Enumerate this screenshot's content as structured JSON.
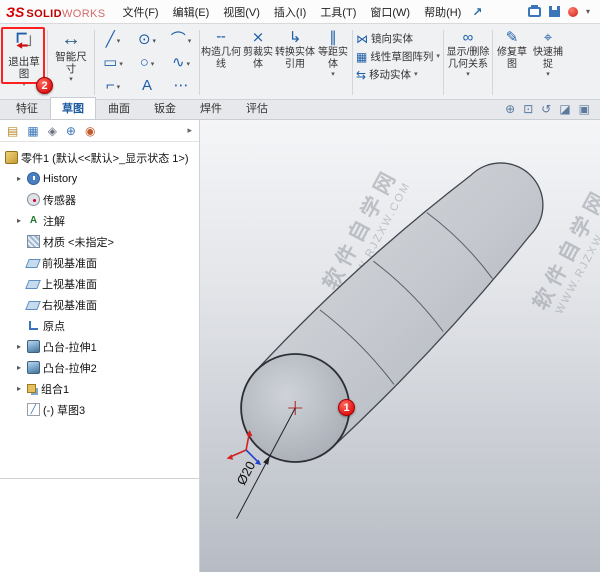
{
  "colors": {
    "annotation_red": "#ff2020",
    "solidworks_red": "#c00000",
    "accent_blue": "#1f5fa9"
  },
  "titlebar": {
    "logo_mark": "ЗS",
    "logo_solid": "SOLID",
    "logo_works": "WORKS",
    "menus": [
      "文件(F)",
      "编辑(E)",
      "视图(V)",
      "插入(I)",
      "工具(T)",
      "窗口(W)",
      "帮助(H)"
    ]
  },
  "ribbon": {
    "exit_sketch": "退出草图",
    "smart_dimension": "智能尺寸",
    "tools": [
      "构造几何线",
      "剪裁实体",
      "转换实体引用",
      "等距实体"
    ],
    "stack_tools": [
      "镜向实体",
      "线性草图阵列",
      "移动实体"
    ],
    "relations": "显示/删除几何关系",
    "repair": "修复草图",
    "snaps": "快速捕捉"
  },
  "tabs": {
    "items": [
      "特征",
      "草图",
      "曲面",
      "钣金",
      "焊件",
      "评估"
    ],
    "active": "草图"
  },
  "tree": {
    "root": "零件1 (默认<<默认>_显示状态 1>)",
    "items": [
      {
        "label": "History"
      },
      {
        "label": "传感器"
      },
      {
        "label": "注解"
      },
      {
        "label": "材质 <未指定>"
      },
      {
        "label": "前视基准面"
      },
      {
        "label": "上视基准面"
      },
      {
        "label": "右视基准面"
      },
      {
        "label": "原点"
      },
      {
        "label": "凸台-拉伸1"
      },
      {
        "label": "凸台-拉伸2"
      },
      {
        "label": "组合1"
      },
      {
        "label": "(-) 草图3"
      }
    ]
  },
  "viewport": {
    "dimension_label": "Ø20",
    "callout_1": "1",
    "callout_2": "2",
    "watermark_line1": "软件自学网",
    "watermark_line2": "WWW.RJZXW.COM"
  },
  "icons": {
    "caret": "▾",
    "expand": "▸",
    "flyout": "↗",
    "line_tool": "╱",
    "circle_tool": "⊙",
    "arc_tool": "⌒",
    "rect_tool": "▭",
    "ellipse_tool": "○",
    "spline_tool": "∿",
    "fillet_tool": "⌐",
    "text_tool": "A",
    "more_tool": "⋯",
    "smart_dim": "↔",
    "construction": "╌",
    "trim": "⨯",
    "convert": "↳",
    "offset": "∥",
    "mirror": "⋈",
    "pattern": "▦",
    "move": "⇆",
    "relations_icon": "∞",
    "repair_icon": "✎",
    "snaps_icon": "⌖",
    "zoom_area": "⊕",
    "zoom_fit": "⊡",
    "rotate_view": "↺",
    "section_view": "◪",
    "view_orient": "▣",
    "fm_tab": "▤",
    "pm_tab": "▦",
    "cm_tab": "◈",
    "dx_tab": "⊕",
    "dm_tab": "◉"
  }
}
